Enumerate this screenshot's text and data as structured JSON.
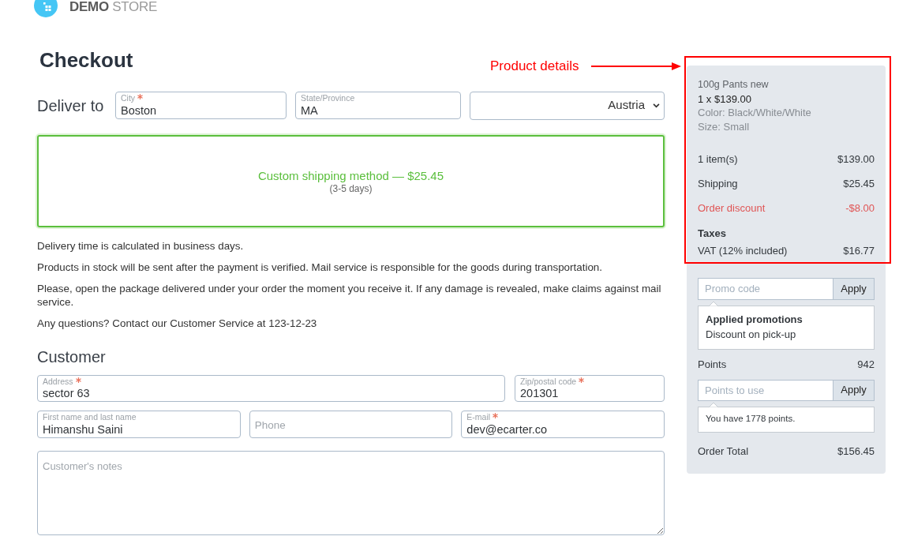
{
  "header": {
    "store_name": "**DEMO** STORE"
  },
  "page_title": "Checkout",
  "delivery": {
    "heading": "Deliver to",
    "fields": [
      {
        "label": "City",
        "required": true,
        "value": "Boston"
      },
      {
        "label": "State/Province",
        "required": false,
        "value": "MA"
      }
    ],
    "country": {
      "value": "Austria"
    }
  },
  "shipping_method": {
    "name": "Custom shipping method — $25.45",
    "duration": "(3-5 days)",
    "selected": true
  },
  "delivery_notes": [
    "Delivery time is calculated in business days.",
    "Products in stock will be sent after the payment is verified. Mail service is responsible for the goods during transportation.",
    "Please, open the package delivered under your order the moment you receive it. If any damage is revealed, make claims against mail service.",
    "Any questions? Contact our Customer Service at 123-12-23"
  ],
  "customer": {
    "heading": "Customer",
    "fields": [
      {
        "label": "Address",
        "required": true,
        "value": "sector 63"
      },
      {
        "label": "Zip/postal code",
        "required": true,
        "value": "201301"
      },
      {
        "label": "First name and last name",
        "required": false,
        "value": "Himanshu Saini"
      },
      {
        "placeholder": "Phone",
        "required": false
      },
      {
        "label": "E-mail",
        "required": true,
        "value": "dev@ecarter.co"
      }
    ],
    "notes_field": {
      "placeholder": "Customer's notes"
    }
  },
  "summary": {
    "product": {
      "name": "100g Pants new",
      "quantity_price": "1 x $139.00",
      "attributes": [
        "Color: Black/White/White",
        "Size: Small"
      ]
    },
    "lines": [
      {
        "kind": "normal",
        "label": "1 item(s)",
        "amount": "$139.00"
      },
      {
        "kind": "normal",
        "label": "Shipping",
        "amount": "$25.45"
      },
      {
        "kind": "discount",
        "label": "Order discount",
        "amount": "-$8.00"
      }
    ],
    "taxes": {
      "heading": "Taxes",
      "lines": [
        {
          "label": "VAT (12% included)",
          "amount": "$16.77"
        }
      ]
    },
    "promo": {
      "placeholder": "Promo code",
      "button": "Apply"
    },
    "applied_promotions": {
      "heading": "Applied promotions",
      "items": [
        "Discount on pick-up"
      ]
    },
    "points": {
      "label": "Points",
      "value": "942"
    },
    "points_input": {
      "placeholder": "Points to use",
      "button": "Apply"
    },
    "points_note": "You have 1778 points.",
    "total": {
      "label": "Order Total",
      "amount": "$156.45"
    }
  },
  "annotation": {
    "label": "Product details"
  }
}
